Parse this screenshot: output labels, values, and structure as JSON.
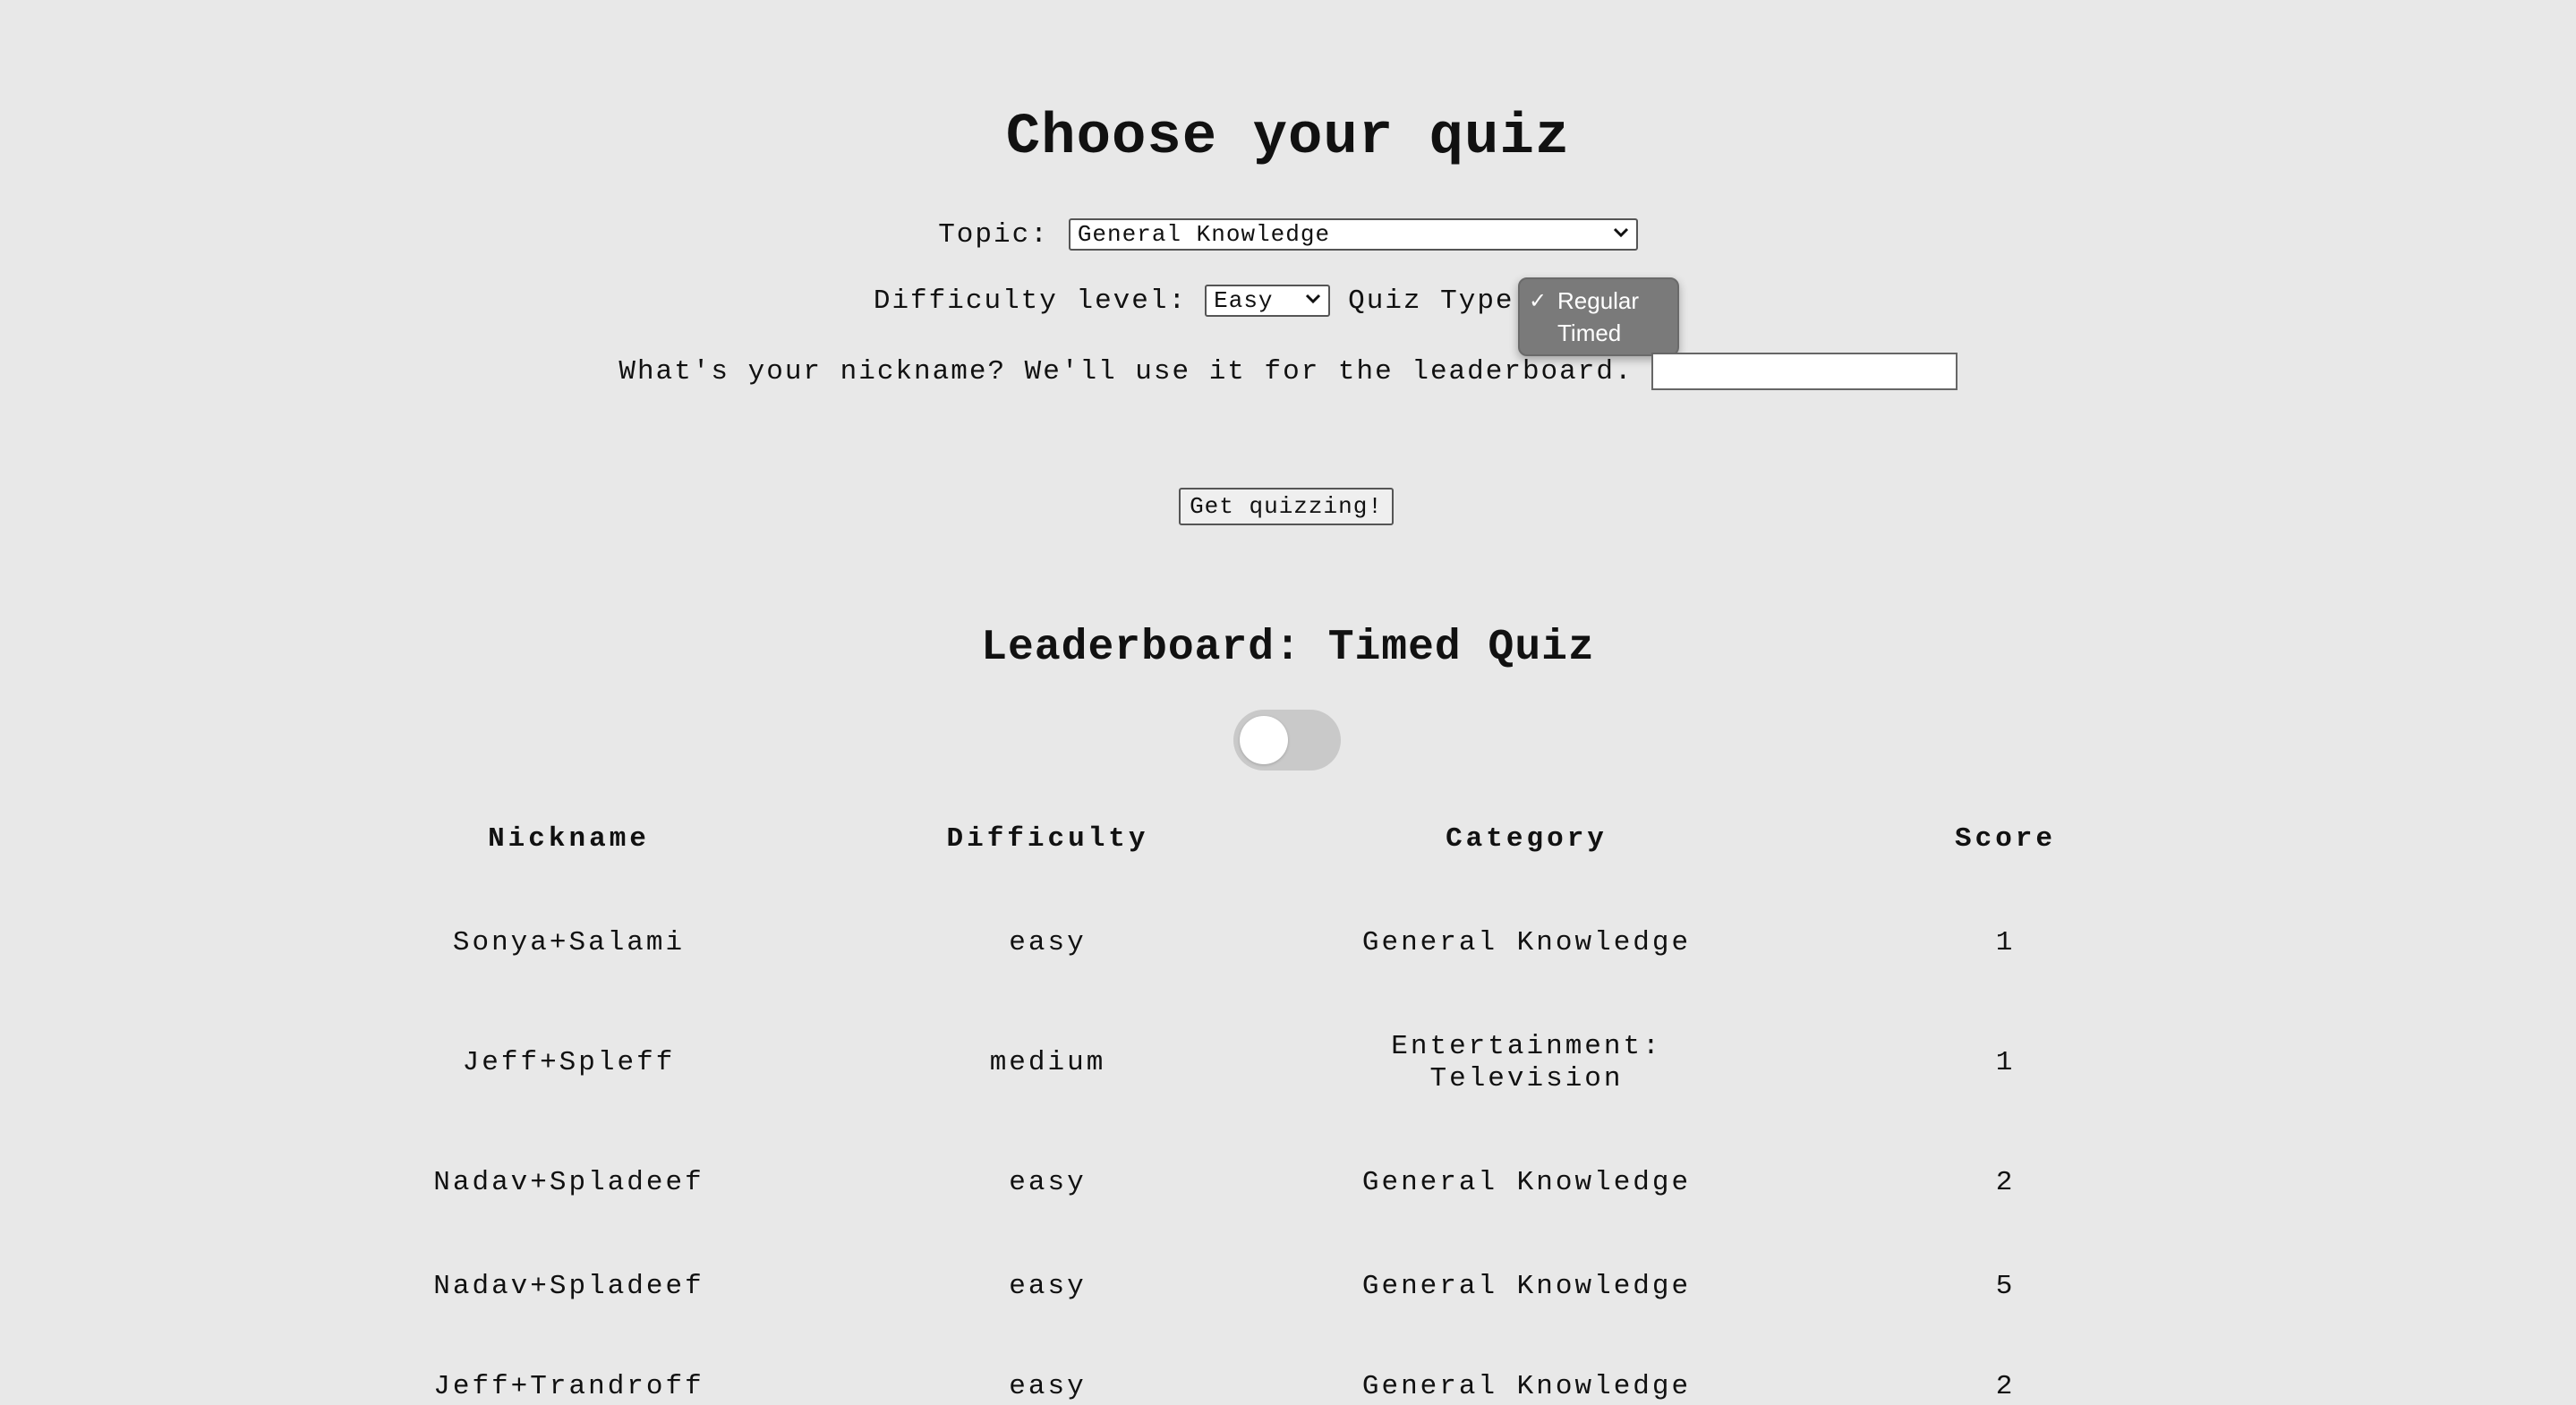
{
  "title": "Choose your quiz",
  "topic": {
    "label": "Topic:",
    "selected": "General Knowledge"
  },
  "difficulty": {
    "label": "Difficulty level:",
    "selected": "Easy"
  },
  "quiz_type": {
    "label": "Quiz Type:",
    "options": [
      {
        "label": "Regular",
        "checked": "✓"
      },
      {
        "label": "Timed",
        "checked": ""
      }
    ]
  },
  "nickname": {
    "label": "What's your nickname? We'll use it for the leaderboard.",
    "value": ""
  },
  "submit_label": "Get quizzing!",
  "leaderboard": {
    "title": "Leaderboard: Timed Quiz",
    "toggle_on": false,
    "headers": [
      "Nickname",
      "Difficulty",
      "Category",
      "Score"
    ],
    "rows": [
      [
        "Sonya+Salami",
        "easy",
        "General Knowledge",
        "1"
      ],
      [
        "Jeff+Spleff",
        "medium",
        "Entertainment: Television",
        "1"
      ],
      [
        "Nadav+Spladeef",
        "easy",
        "General Knowledge",
        "2"
      ],
      [
        "Nadav+Spladeef",
        "easy",
        "General Knowledge",
        "5"
      ],
      [
        "Jeff+Trandroff",
        "easy",
        "General Knowledge",
        "2"
      ]
    ]
  },
  "colors": {
    "background": "#e8e8e8",
    "dropdown": "#7a7a7a",
    "toggle_off": "#c9c9c9"
  }
}
